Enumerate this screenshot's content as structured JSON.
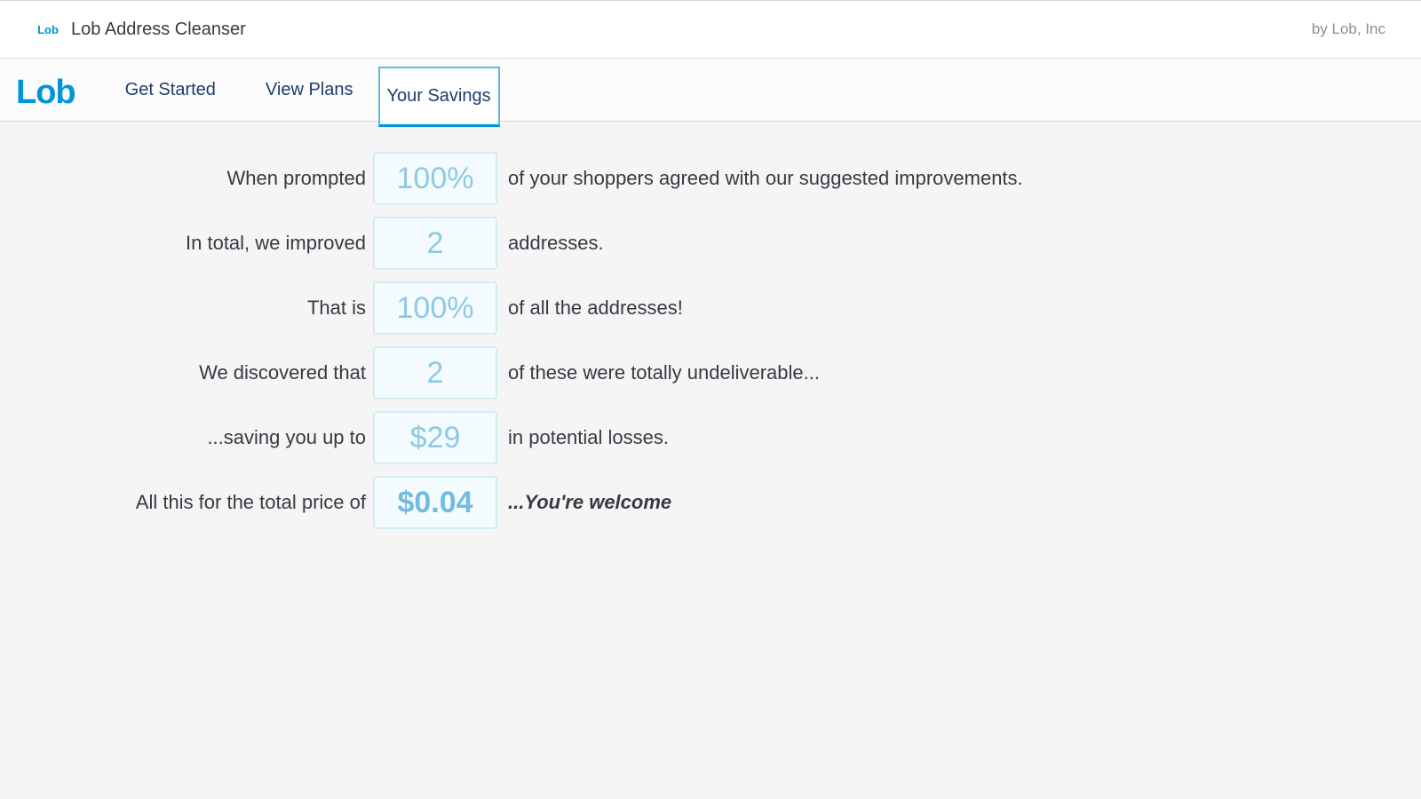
{
  "header": {
    "icon_text": "Lob",
    "title": "Lob Address Cleanser",
    "by_line": "by Lob, Inc"
  },
  "nav": {
    "logo": "Lob",
    "items": [
      {
        "label": "Get Started",
        "active": false
      },
      {
        "label": "View Plans",
        "active": false
      },
      {
        "label": "Your Savings",
        "active": true
      }
    ]
  },
  "savings": {
    "rows": [
      {
        "lead": "When prompted",
        "value": "100%",
        "trail": "of your shoppers agreed with our suggested improvements.",
        "bold_value": false,
        "bold_trail": false
      },
      {
        "lead": "In total, we improved",
        "value": "2",
        "trail": "addresses.",
        "bold_value": false,
        "bold_trail": false
      },
      {
        "lead": "That is",
        "value": "100%",
        "trail": "of all the addresses!",
        "bold_value": false,
        "bold_trail": false
      },
      {
        "lead": "We discovered that",
        "value": "2",
        "trail": "of these were totally undeliverable...",
        "bold_value": false,
        "bold_trail": false
      },
      {
        "lead": "...saving you up to",
        "value": "$29",
        "trail": "in potential losses.",
        "bold_value": false,
        "bold_trail": false
      },
      {
        "lead": "All this for the total price of",
        "value": "$0.04",
        "trail": "...You're welcome",
        "bold_value": true,
        "bold_trail": true
      }
    ]
  }
}
